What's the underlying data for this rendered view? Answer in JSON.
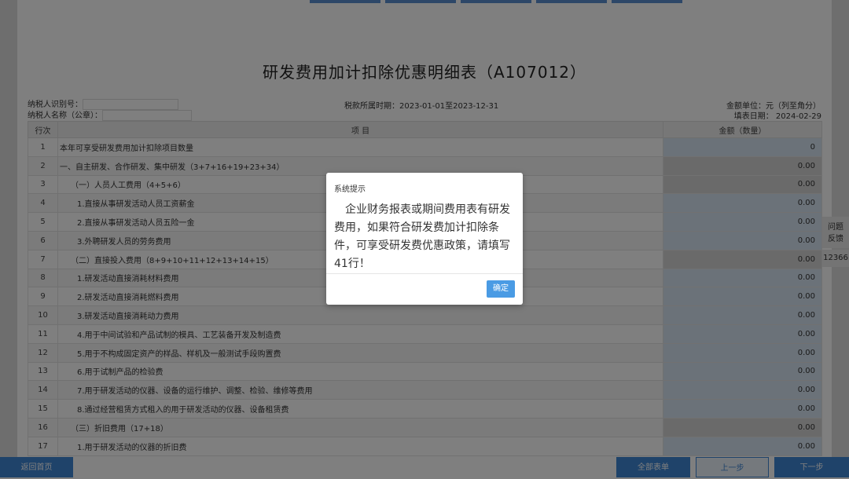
{
  "form": {
    "title": "研发费用加计扣除优惠明细表（A107012）",
    "taxpayer_id_label": "纳税人识别号：",
    "taxpayer_name_label": "纳税人名称（公章）：",
    "tax_period": "税款所属时期：2023-01-01至2023-12-31",
    "amount_unit": "金额单位：元（列至角分）",
    "fill_date": "填表日期： 2024-02-29"
  },
  "table": {
    "headers": [
      "行次",
      "项  目",
      "金额（数量）"
    ],
    "rows": [
      {
        "no": "1",
        "item": "本年可享受研发费用加计扣除项目数量",
        "amount": "0",
        "indent": 0,
        "grey": false
      },
      {
        "no": "2",
        "item": "一、自主研发、合作研发、集中研发（3+7+16+19+23+34）",
        "amount": "0.00",
        "indent": 0,
        "grey": true
      },
      {
        "no": "3",
        "item": "（一）人员人工费用（4+5+6）",
        "amount": "0.00",
        "indent": 1,
        "grey": true
      },
      {
        "no": "4",
        "item": "1.直接从事研发活动人员工资薪金",
        "amount": "0.00",
        "indent": 2,
        "grey": false
      },
      {
        "no": "5",
        "item": "2.直接从事研发活动人员五险一金",
        "amount": "0.00",
        "indent": 2,
        "grey": false
      },
      {
        "no": "6",
        "item": "3.外聘研发人员的劳务费用",
        "amount": "0.00",
        "indent": 2,
        "grey": false
      },
      {
        "no": "7",
        "item": "（二）直接投入费用（8+9+10+11+12+13+14+15）",
        "amount": "0.00",
        "indent": 1,
        "grey": true
      },
      {
        "no": "8",
        "item": "1.研发活动直接消耗材料费用",
        "amount": "0.00",
        "indent": 2,
        "grey": false
      },
      {
        "no": "9",
        "item": "2.研发活动直接消耗燃料费用",
        "amount": "0.00",
        "indent": 2,
        "grey": false
      },
      {
        "no": "10",
        "item": "3.研发活动直接消耗动力费用",
        "amount": "0.00",
        "indent": 2,
        "grey": false
      },
      {
        "no": "11",
        "item": "4.用于中间试验和产品试制的模具、工艺装备开发及制造费",
        "amount": "0.00",
        "indent": 2,
        "grey": false
      },
      {
        "no": "12",
        "item": "5.用于不构成固定资产的样品、样机及一般测试手段购置费",
        "amount": "0.00",
        "indent": 2,
        "grey": false
      },
      {
        "no": "13",
        "item": "6.用于试制产品的检验费",
        "amount": "0.00",
        "indent": 2,
        "grey": false
      },
      {
        "no": "14",
        "item": "7.用于研发活动的仪器、设备的运行维护、调整、检验、维修等费用",
        "amount": "0.00",
        "indent": 2,
        "grey": false
      },
      {
        "no": "15",
        "item": "8.通过经营租赁方式租入的用于研发活动的仪器、设备租赁费",
        "amount": "0.00",
        "indent": 2,
        "grey": false
      },
      {
        "no": "16",
        "item": "（三）折旧费用（17+18）",
        "amount": "0.00",
        "indent": 1,
        "grey": true
      },
      {
        "no": "17",
        "item": "1.用于研发活动的仪器的折旧费",
        "amount": "0.00",
        "indent": 2,
        "grey": false
      }
    ]
  },
  "side": {
    "feedback_line1": "问题",
    "feedback_line2": "反馈",
    "phone": "12366"
  },
  "bottom": {
    "home": "返回首页",
    "all_forms": "全部表单",
    "prev": "上一步",
    "next": "下一步"
  },
  "modal": {
    "title": "系统提示",
    "message": "企业财务报表或期间费用表有研发费用，如果符合研发费加计扣除条件，可享受研发费优惠政策，请填写41行！",
    "ok": "确定"
  }
}
